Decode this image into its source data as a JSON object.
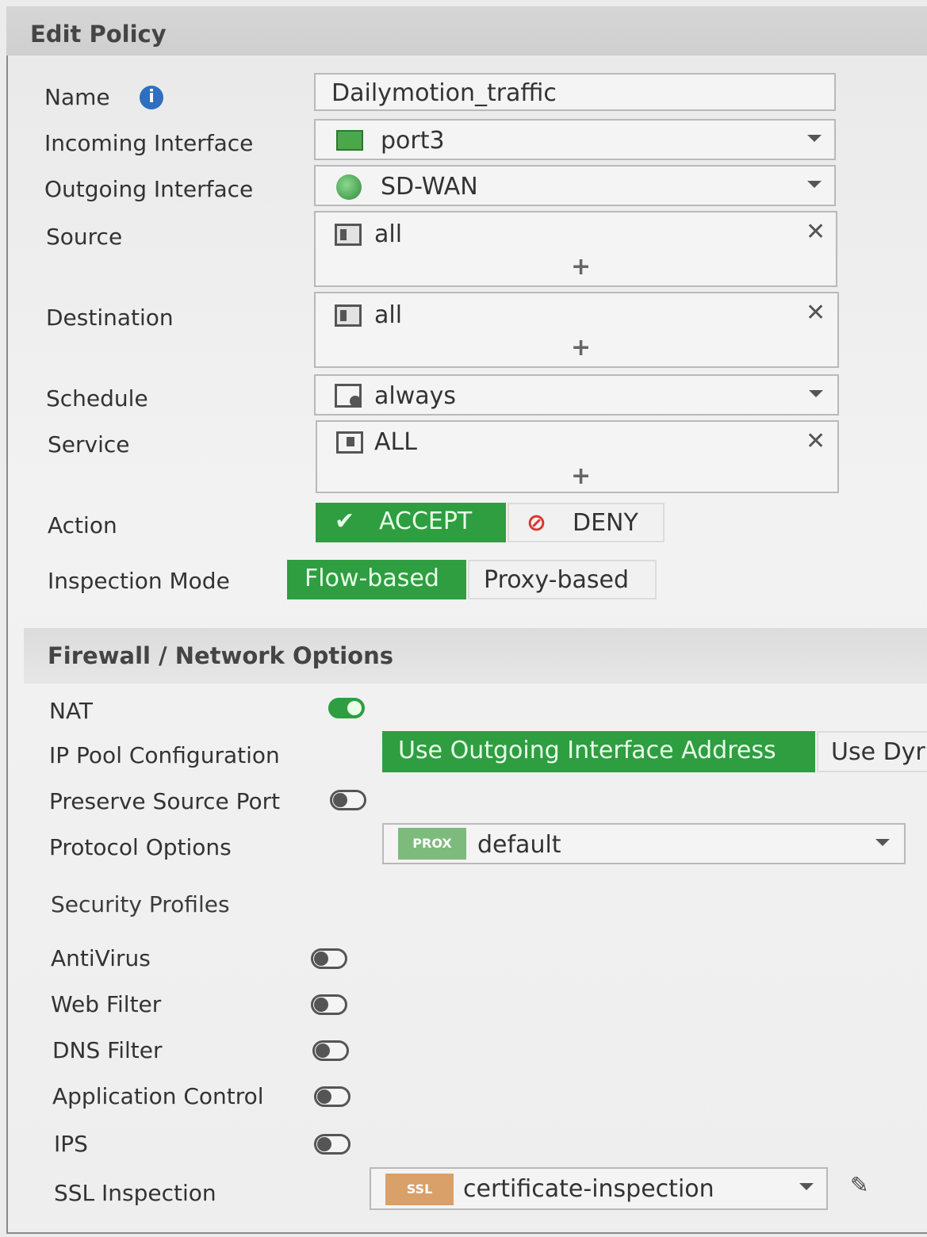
{
  "dialog": {
    "title": "Edit Policy"
  },
  "labels": {
    "name": "Name",
    "incoming": "Incoming Interface",
    "outgoing": "Outgoing Interface",
    "source": "Source",
    "destination": "Destination",
    "schedule": "Schedule",
    "service": "Service",
    "action": "Action",
    "inspection_mode": "Inspection Mode"
  },
  "fields": {
    "name": "Dailymotion_traffic",
    "incoming": "port3",
    "outgoing": "SD-WAN",
    "source": "all",
    "destination": "all",
    "schedule": "always",
    "service": "ALL"
  },
  "action": {
    "accept": "ACCEPT",
    "deny": "DENY",
    "selected": "ACCEPT"
  },
  "inspection_mode": {
    "flow": "Flow-based",
    "proxy": "Proxy-based",
    "selected": "Flow-based"
  },
  "firewall": {
    "title": "Firewall / Network Options",
    "nat_label": "NAT",
    "nat": true,
    "ip_pool_label": "IP Pool Configuration",
    "ip_pool_selected": "Use Outgoing Interface Address",
    "ip_pool_other": "Use Dyr",
    "preserve_port_label": "Preserve Source Port",
    "preserve_port": false,
    "protocol_label": "Protocol Options",
    "protocol_badge": "PROX",
    "protocol_value": "default"
  },
  "security": {
    "title": "Security Profiles",
    "items": [
      {
        "label": "AntiVirus",
        "enabled": false
      },
      {
        "label": "Web Filter",
        "enabled": false
      },
      {
        "label": "DNS Filter",
        "enabled": false
      },
      {
        "label": "Application Control",
        "enabled": false
      },
      {
        "label": "IPS",
        "enabled": false
      }
    ],
    "ssl_label": "SSL Inspection",
    "ssl_badge": "SSL",
    "ssl_value": "certificate-inspection"
  },
  "colors": {
    "accent_green": "#2e9e41",
    "deny_red": "#d9362f",
    "ssl_badge": "#d9a06a",
    "prox_badge": "#7dbb7d"
  }
}
